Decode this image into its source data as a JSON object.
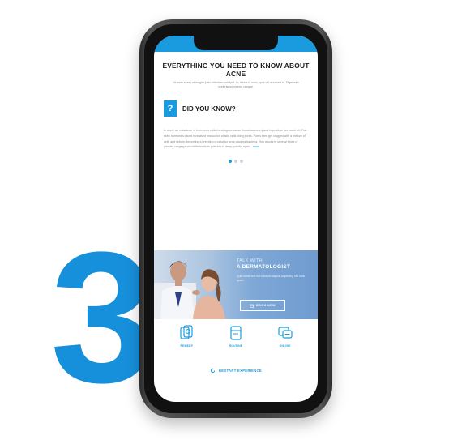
{
  "feature_step_number": "3",
  "colors": {
    "accent": "#1a9be0",
    "number_blue": "#1790dc",
    "banner_blue": "#7fa8d6"
  },
  "article": {
    "heading": "EVERYTHING YOU NEED TO KNOW ABOUT ACNE",
    "subtext": "Ut enim lorem ut magna justo interdum volutpat. Ac lectus id nunc, quis vel arcu sed et. Dignissim scelerisque viverra congue."
  },
  "did_you_know": {
    "badge": "?",
    "title": "DID YOU KNOW?",
    "body": "In short, an imbalance in hormones called androgens cause the sebaceous gland to produce too much oil. This sebo hormones cause increased production of skin cells lining pores. Pores then get clogged with a mixture of cells and sebum, becoming a breeding ground for acne-causing bacteria. This results in several types of pimples ranging from whiteheads to pustules to deep, painful cysts...",
    "more_link": "more",
    "carousel_total": 3,
    "carousel_active": 1
  },
  "banner": {
    "line1": "TALK WITH",
    "line2": "A DERMATOLOGIST",
    "subtext": "Quis morbi velit est volutpat magna, adipiscing nisi nunc quam.",
    "cta": "BOOK NOW"
  },
  "bottom_nav": [
    {
      "label": "REMEDY",
      "icon": "cream-tube-icon"
    },
    {
      "label": "ROUTINE",
      "icon": "bottle-icon"
    },
    {
      "label": "ONLINE",
      "icon": "chat-icon"
    }
  ],
  "restart": {
    "label": "RESTART EXPERIENCE",
    "icon": "restart-icon"
  }
}
